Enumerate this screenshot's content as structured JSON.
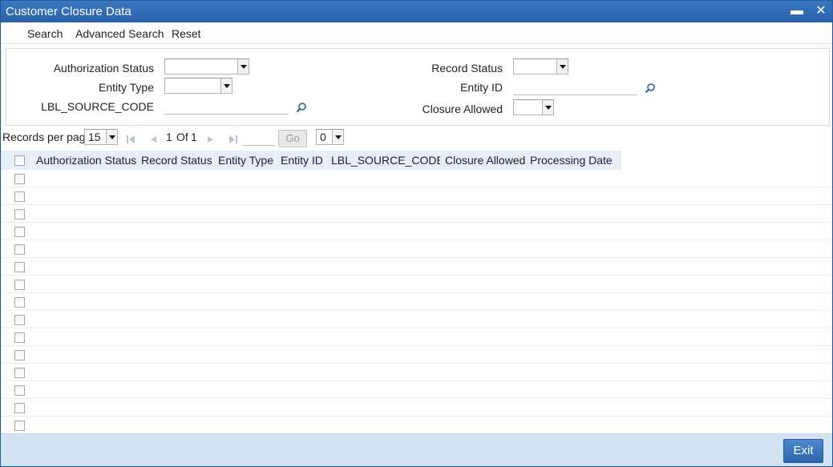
{
  "window": {
    "title": "Customer Closure Data",
    "minimize_glyph": "▬",
    "close_glyph": "✕"
  },
  "toolbar": {
    "search_label": "Search",
    "advanced_search_label": "Advanced Search",
    "reset_label": "Reset"
  },
  "criteria": {
    "authorization_status": {
      "label": "Authorization Status",
      "value": ""
    },
    "entity_type": {
      "label": "Entity Type",
      "value": ""
    },
    "source_code": {
      "label": "LBL_SOURCE_CODE",
      "value": ""
    },
    "record_status": {
      "label": "Record Status",
      "value": ""
    },
    "entity_id": {
      "label": "Entity ID",
      "value": ""
    },
    "closure_allowed": {
      "label": "Closure Allowed",
      "value": ""
    }
  },
  "pager": {
    "records_per_page_label": "Records per page",
    "records_per_page_value": "15",
    "current_page": "1",
    "of_label": "Of",
    "total_pages": "1",
    "goto_value": "",
    "go_label": "Go",
    "extra_select_value": "0"
  },
  "grid": {
    "columns": [
      "Authorization Status",
      "Record Status",
      "Entity Type",
      "Entity ID",
      "LBL_SOURCE_CODE",
      "Closure Allowed",
      "Processing Date"
    ],
    "rows": []
  },
  "footer": {
    "exit_label": "Exit"
  },
  "icons": {
    "lookup": "magnifier-icon",
    "first": "first-page-icon",
    "prev": "previous-page-icon",
    "next": "next-page-icon",
    "last": "last-page-icon"
  },
  "colors": {
    "titlebar": "#2a62a9",
    "header_bg": "#e6eef8",
    "footer_bg": "#d3e3f4",
    "exit_button": "#3b76bd"
  }
}
